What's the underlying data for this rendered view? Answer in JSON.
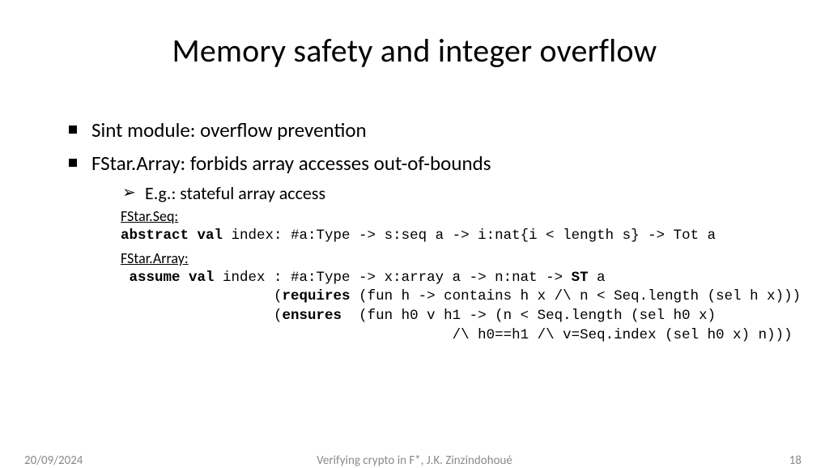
{
  "title": "Memory safety and integer overflow",
  "bullets": {
    "b1": "Sint module: overflow prevention",
    "b2": "FStar.Array: forbids array accesses out-of-bounds",
    "sub1": "E.g.: stateful array access"
  },
  "code": {
    "label1": "FStar.Seq:",
    "line1a": "abstract val",
    "line1b": " index: #a:Type -> s:seq a -> i:nat{i < length s} -> Tot a",
    "label2": "FStar.Array:",
    "line2a": " assume val",
    "line2b": " index : #a:Type -> x:array a -> n:nat -> ",
    "line2c": "ST",
    "line2d": " a",
    "line3a": "                  (",
    "line3b": "requires",
    "line3c": " (fun h -> contains h x /\\ n < Seq.length (sel h x)))",
    "line4a": "                  (",
    "line4b": "ensures",
    "line4c": "  (fun h0 v h1 -> (n < Seq.length (sel h0 x)",
    "line5": "                                       /\\ h0==h1 /\\ v=Seq.index (sel h0 x) n)))"
  },
  "footer": {
    "date": "20/09/2024",
    "title": "Verifying crypto  in F*, J.K. Zinzindohoué",
    "page": "18"
  }
}
